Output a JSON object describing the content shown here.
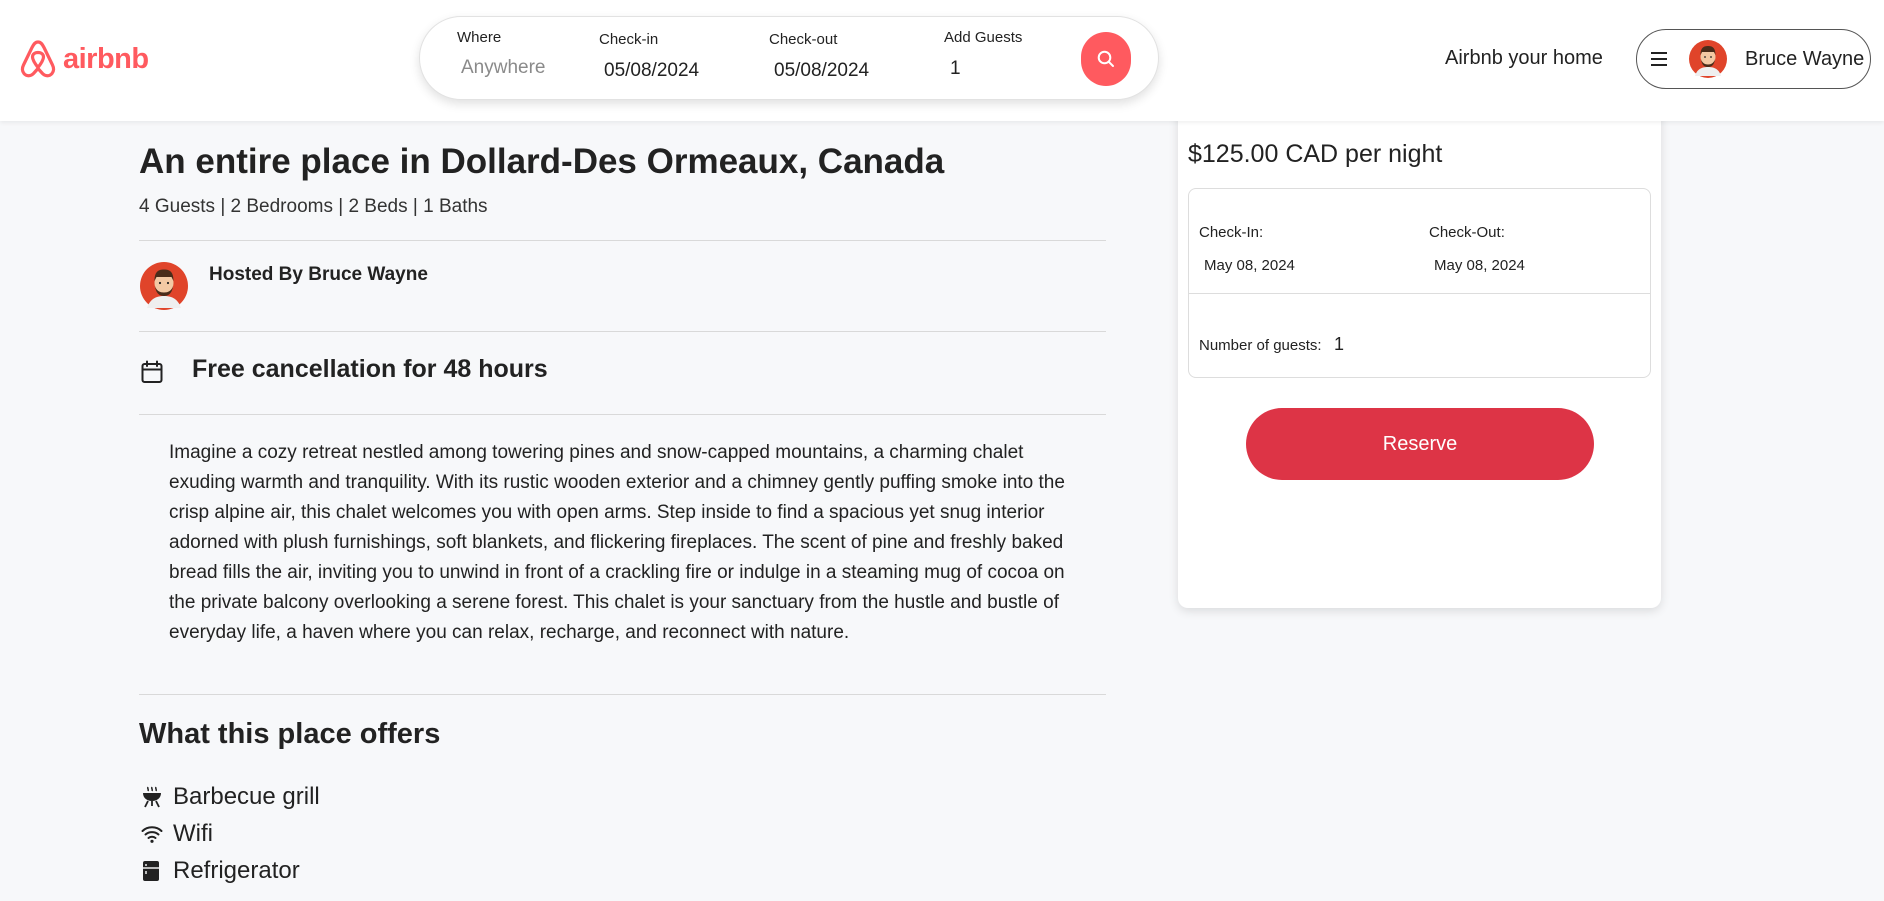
{
  "colors": {
    "brand": "#ff5a5f",
    "reserve": "#dd3446"
  },
  "header": {
    "logo_text": "airbnb",
    "search": {
      "where_label": "Where",
      "where_placeholder": "Anywhere",
      "checkin_label": "Check-in",
      "checkin_value": "05/08/2024",
      "checkout_label": "Check-out",
      "checkout_value": "05/08/2024",
      "guests_label": "Add Guests",
      "guests_value": "1",
      "search_icon": "search-icon"
    },
    "host_link": "Airbnb your home",
    "user_name": "Bruce Wayne",
    "menu_icon": "hamburger-icon"
  },
  "listing": {
    "title": "An entire place in Dollard-Des Ormeaux, Canada",
    "details": "4 Guests | 2 Bedrooms | 2 Beds | 1 Baths",
    "host": "Hosted By Bruce Wayne",
    "cancellation": "Free cancellation for 48 hours",
    "description": "Imagine a cozy retreat nestled among towering pines and snow-capped mountains, a charming chalet exuding warmth and tranquility. With its rustic wooden exterior and a chimney gently puffing smoke into the crisp alpine air, this chalet welcomes you with open arms. Step inside to find a spacious yet snug interior adorned with plush furnishings, soft blankets, and flickering fireplaces. The scent of pine and freshly baked bread fills the air, inviting you to unwind in front of a crackling fire or indulge in a steaming mug of cocoa on the private balcony overlooking a serene forest. This chalet is your sanctuary from the hustle and bustle of everyday life, a haven where you can relax, recharge, and reconnect with nature.",
    "offers_title": "What this place offers",
    "amenities": [
      {
        "label": "Barbecue grill",
        "icon": "grill-icon"
      },
      {
        "label": "Wifi",
        "icon": "wifi-icon"
      },
      {
        "label": "Refrigerator",
        "icon": "refrigerator-icon"
      }
    ]
  },
  "booking": {
    "price": "$125.00 CAD per night",
    "checkin_label": "Check-In:",
    "checkin_value": "May 08, 2024",
    "checkout_label": "Check-Out:",
    "checkout_value": "May 08, 2024",
    "guests_label": "Number of guests:",
    "guests_value": "1",
    "reserve_label": "Reserve"
  }
}
